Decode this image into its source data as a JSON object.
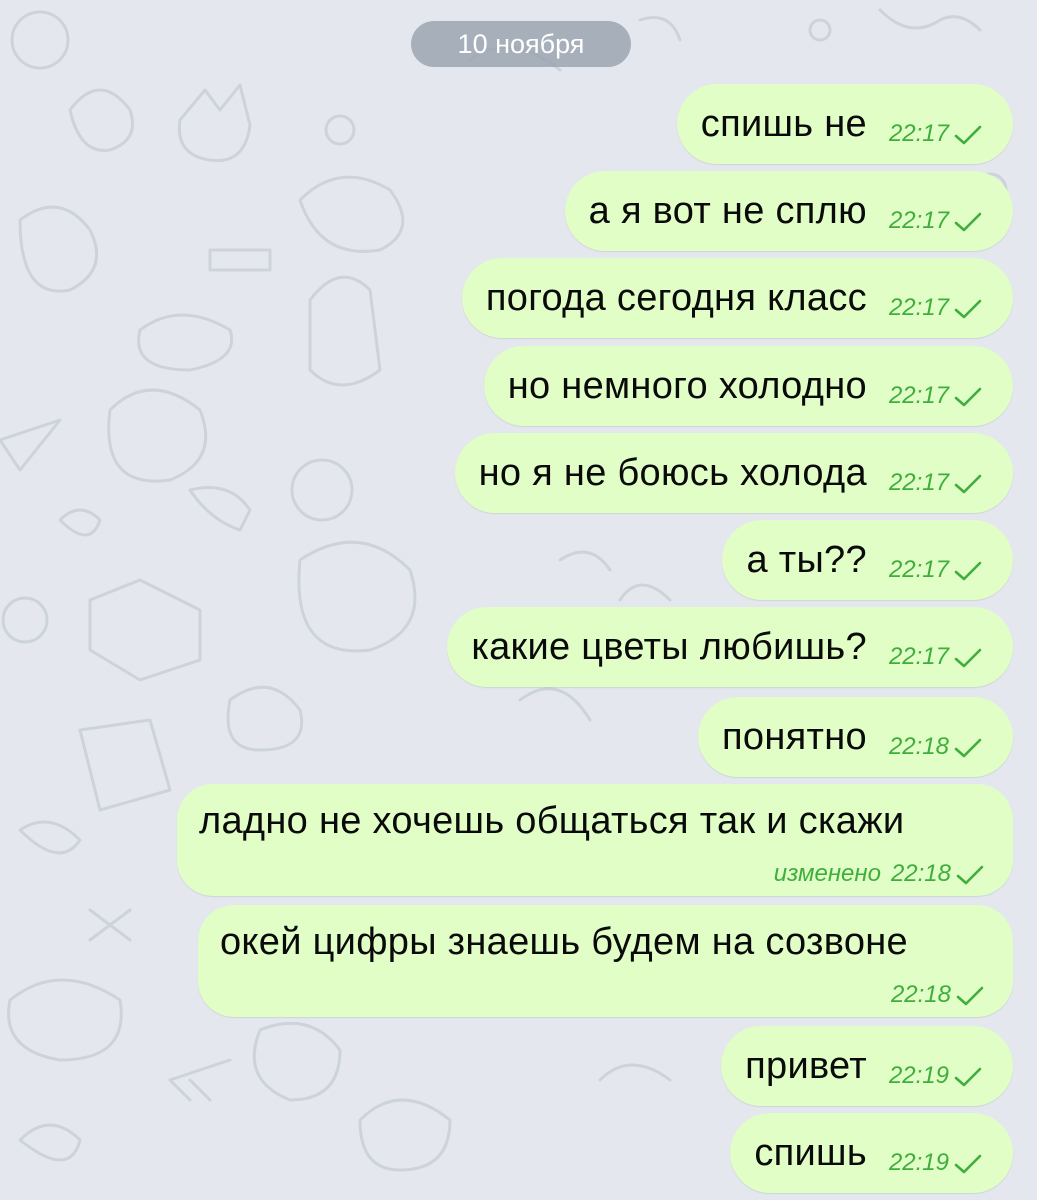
{
  "chat": {
    "date_divider": "10 ноября",
    "messages": [
      {
        "text": "спишь не",
        "time": "22:17"
      },
      {
        "text": "а я вот не сплю",
        "time": "22:17"
      },
      {
        "text": "погода сегодня класс",
        "time": "22:17"
      },
      {
        "text": "но немного холодно",
        "time": "22:17"
      },
      {
        "text": "но я не боюсь холода",
        "time": "22:17"
      },
      {
        "text": "а ты??",
        "time": "22:17"
      },
      {
        "text": "какие цветы любишь?",
        "time": "22:17"
      },
      {
        "text": "понятно",
        "time": "22:18"
      },
      {
        "text": "ладно не хочешь общаться так и скажи",
        "time": "22:18",
        "edited_label": "изменено"
      },
      {
        "text": "окей цифры знаешь будем на созвоне",
        "time": "22:18"
      },
      {
        "text": "привет",
        "time": "22:19"
      },
      {
        "text": "спишь",
        "time": "22:19"
      }
    ]
  },
  "icons": {
    "read_status": "single-check-icon"
  },
  "colors": {
    "background": "#e4e8ee",
    "outgoing_bubble": "#e1fec6",
    "timestamp": "#3fae3c",
    "date_pill": "#96a0ac"
  }
}
